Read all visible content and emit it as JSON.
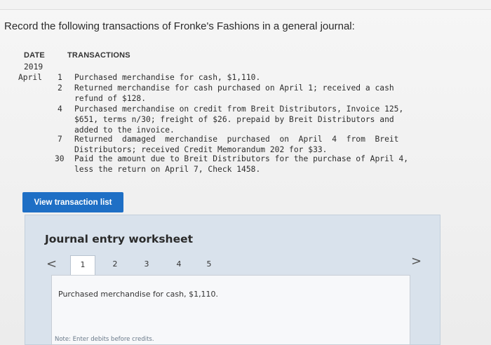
{
  "question": "Record the following transactions of Fronke's Fashions in a general journal:",
  "table": {
    "date_header": "DATE",
    "transactions_header": "TRANSACTIONS",
    "year": "2019",
    "month": "April"
  },
  "transactions": [
    {
      "day": "1",
      "lines": [
        "Purchased merchandise for cash, $1,110."
      ]
    },
    {
      "day": "2",
      "lines": [
        "Returned merchandise for cash purchased on April 1; received a cash",
        "refund of $128."
      ]
    },
    {
      "day": "4",
      "lines": [
        "Purchased merchandise on credit from Breit Distributors, Invoice 125,",
        "$651, terms n/30; freight of $26. prepaid by Breit Distributors and",
        "added to the invoice."
      ]
    },
    {
      "day": "7",
      "lines": [
        "Returned  damaged  merchandise  purchased  on  April  4  from  Breit",
        "Distributors; received Credit Memorandum 202 for $33."
      ]
    },
    {
      "day": "30",
      "lines": [
        "Paid the amount due to Breit Distributors for the purchase of April 4,",
        "less the return on April 7, Check 1458."
      ]
    }
  ],
  "view_button": "View transaction list",
  "worksheet": {
    "title": "Journal entry worksheet",
    "prev_arrow": "<",
    "next_arrow": ">",
    "tabs": [
      "1",
      "2",
      "3",
      "4",
      "5"
    ],
    "active_tab": "1",
    "content": "Purchased merchandise for cash, $1,110.",
    "note": "Note: Enter debits before credits."
  }
}
